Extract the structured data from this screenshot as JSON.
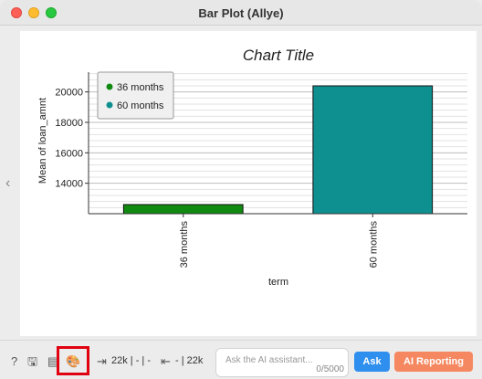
{
  "window": {
    "title": "Bar Plot (Allye)"
  },
  "nav": {
    "back_icon": "‹"
  },
  "chart_data": {
    "type": "bar",
    "title": "Chart Title",
    "xlabel": "term",
    "ylabel": "Mean of loan_amnt",
    "categories": [
      "36 months",
      "60 months"
    ],
    "values": [
      12600,
      20400
    ],
    "colors": [
      "#118a11",
      "#0f9090"
    ],
    "ylim": [
      12000,
      21300
    ],
    "yticks": [
      "14000",
      "16000",
      "18000",
      "20000"
    ],
    "legend": {
      "placement": "top-left",
      "entries": [
        "36 months",
        "60 months"
      ]
    },
    "grid": true
  },
  "toolbar": {
    "help_icon": "?",
    "save_icon": "🖫",
    "doc_icon": "▤",
    "palette_icon": "🎨",
    "stat_in": "22k | - | -",
    "stat_out": "- | 22k",
    "in_icon": "⇥",
    "out_icon": "⇤"
  },
  "assistant": {
    "placeholder": "Ask the AI assistant...",
    "value": "",
    "counter": "0/5000",
    "ask_label": "Ask",
    "ai_reporting_label": "AI Reporting"
  }
}
